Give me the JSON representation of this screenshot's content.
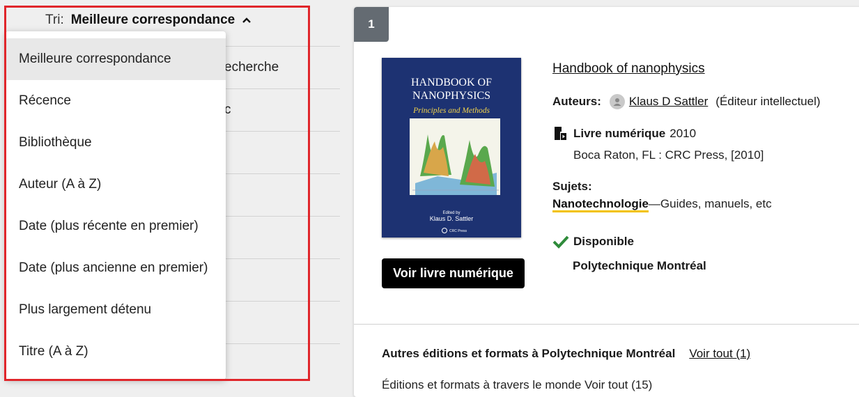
{
  "sort": {
    "label": "Tri:",
    "value": "Meilleure correspondance",
    "options": [
      "Meilleure correspondance",
      "Récence",
      "Bibliothèque",
      "Auteur (A à Z)",
      "Date (plus récente en premier)",
      "Date (plus ancienne en premier)",
      "Plus largement détenu",
      "Titre (A à Z)"
    ],
    "selected_index": 0
  },
  "background_panel": {
    "row_texts": [
      "echerche",
      "c"
    ]
  },
  "result": {
    "rank": "1",
    "title": "Handbook of nanophysics",
    "authors_label": "Auteurs:",
    "author_name": "Klaus D Sattler",
    "author_role": "(Éditeur intellectuel)",
    "format_label": "Livre numérique",
    "year": "2010",
    "publisher": "Boca Raton, FL : CRC Press, [2010]",
    "subjects_label": "Sujets:",
    "subject_main": "Nanotechnologie",
    "subject_rest": "—Guides, manuels, etc",
    "availability": "Disponible",
    "library": "Polytechnique Montréal",
    "ebook_button": "Voir livre numérique",
    "cover": {
      "line1": "HANDBOOK OF",
      "line2": "NANOPHYSICS",
      "subtitle": "Principles and Methods",
      "edited_by": "Edited by",
      "editor": "Klaus D. Sattler",
      "publisher_logo": "CRC Press"
    }
  },
  "other_editions": {
    "label": "Autres éditions et formats à Polytechnique Montréal",
    "link": "Voir tout (1)",
    "next_line": "Éditions et formats à travers le monde   Voir tout (15)"
  },
  "colors": {
    "highlight_border": "#e0262b",
    "check_green": "#2e8b3a",
    "subject_underline": "#f2c200",
    "cover_blue": "#1d3272"
  },
  "icons": [
    "chevron-up-icon",
    "person-icon",
    "ebook-icon",
    "checkmark-icon"
  ]
}
